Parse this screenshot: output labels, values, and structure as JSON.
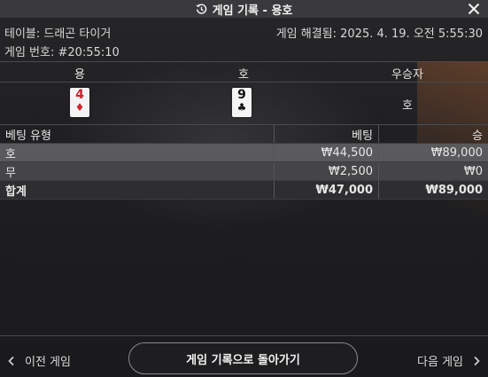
{
  "window": {
    "title": "게임 기록 - 용호"
  },
  "info": {
    "table": "테이블: 드래곤 타이거",
    "game_number": "게임 번호: #20:55:10",
    "settled": "게임 해결됨: 2025. 4. 19. 오전 5:55:30"
  },
  "result": {
    "headers": [
      "용",
      "호",
      "우승자"
    ],
    "dragon_card": {
      "rank": "4",
      "suit": "♦",
      "color": "#d4202a"
    },
    "tiger_card": {
      "rank": "9",
      "suit": "♣",
      "color": "#111111"
    },
    "winner": "호"
  },
  "bets": {
    "headers": [
      "베팅 유형",
      "베팅",
      "승"
    ],
    "rows": [
      {
        "type": "호",
        "bet": "₩44,500",
        "win": "₩89,000"
      },
      {
        "type": "무",
        "bet": "₩2,500",
        "win": "₩0"
      },
      {
        "type": "합계",
        "bet": "₩47,000",
        "win": "₩89,000"
      }
    ]
  },
  "footer": {
    "prev": "이전 게임",
    "back": "게임 기록으로 돌아가기",
    "next": "다음 게임"
  },
  "icons": {
    "title": "history-icon",
    "close": "close-icon",
    "prev": "chevron-left-icon",
    "next": "chevron-right-icon"
  }
}
